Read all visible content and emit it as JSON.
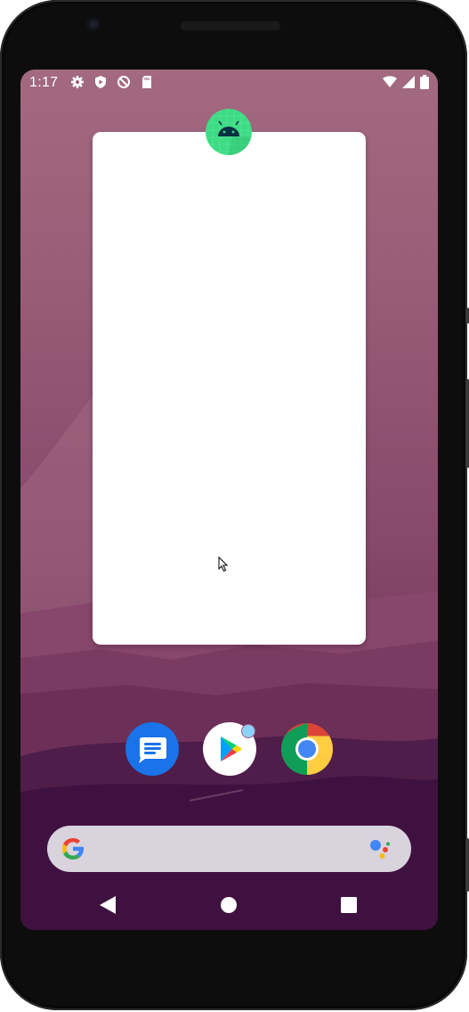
{
  "status_bar": {
    "time": "1:17",
    "left_icons": [
      "settings-icon",
      "play-protect-icon",
      "data-saver-icon",
      "sd-card-icon"
    ],
    "right_icons": [
      "wifi-icon",
      "cell-signal-icon",
      "battery-icon"
    ]
  },
  "widget": {
    "app_icon": "android-app-icon"
  },
  "dock": {
    "apps": [
      {
        "name": "messages-app-icon",
        "color": "#1a73e8"
      },
      {
        "name": "play-store-app-icon",
        "color": "#ffffff",
        "notification_dot": "#8ad4f7"
      },
      {
        "name": "chrome-app-icon",
        "color": "#4285f4"
      }
    ]
  },
  "search_bar": {
    "logo": "google-g-icon",
    "assistant": "google-assistant-icon"
  },
  "nav_bar": {
    "buttons": [
      "back-button",
      "home-button",
      "recents-button"
    ]
  },
  "colors": {
    "wallpaper_top": "#a2697f",
    "wallpaper_bottom": "#3b1038",
    "android_green": "#3ddc84",
    "search_bar": "#d9d3de"
  }
}
